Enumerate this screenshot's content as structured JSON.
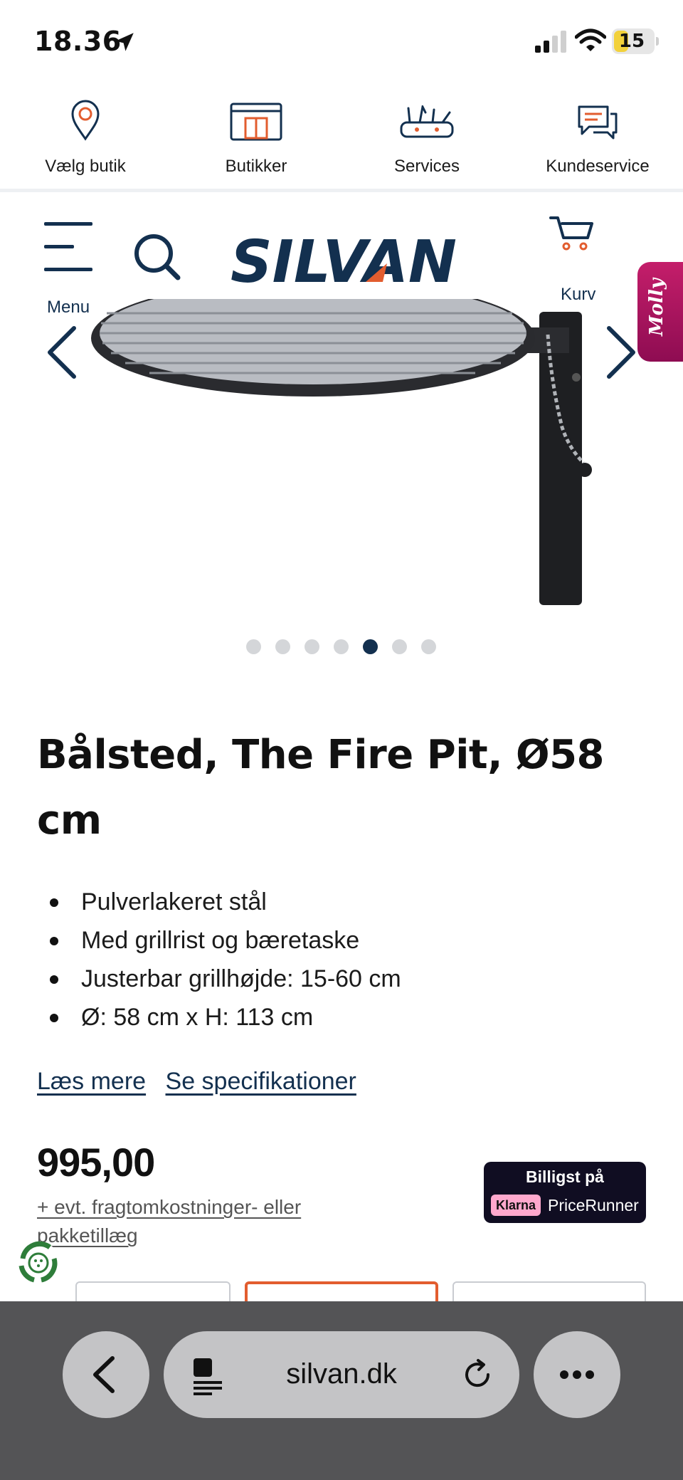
{
  "status_bar": {
    "time": "18.36",
    "battery": "15"
  },
  "top_nav": [
    {
      "label": "Vælg butik",
      "icon": "location-pin-icon"
    },
    {
      "label": "Butikker",
      "icon": "store-icon"
    },
    {
      "label": "Services",
      "icon": "tools-icon"
    },
    {
      "label": "Kundeservice",
      "icon": "chat-icon"
    }
  ],
  "header": {
    "menu_label": "Menu",
    "cart_label": "Kurv",
    "logo_text": "SILVAN",
    "chat_widget": "Molly"
  },
  "gallery": {
    "dot_count": 7,
    "active_index": 4
  },
  "product": {
    "title": "Bålsted, The Fire Pit, Ø58 cm",
    "features": [
      "Pulverlakeret stål",
      "Med grillrist og bæretaske",
      "Justerbar grillhøjde: 15-60 cm",
      "Ø: 58 cm x H: 113 cm"
    ],
    "read_more": "Læs mere",
    "specifications": "Se specifikationer",
    "price": "995,00",
    "freight_note": "+ evt. fragtomkostninger- eller pakketillæg",
    "pricerunner_top": "Billigst på",
    "pricerunner_klarna": "Klarna",
    "pricerunner_name": "PriceRunner"
  },
  "browser": {
    "url": "silvan.dk"
  },
  "colors": {
    "brand_navy": "#13304f",
    "accent_orange": "#e25d2f",
    "molly_pink": "#c41e6a"
  }
}
